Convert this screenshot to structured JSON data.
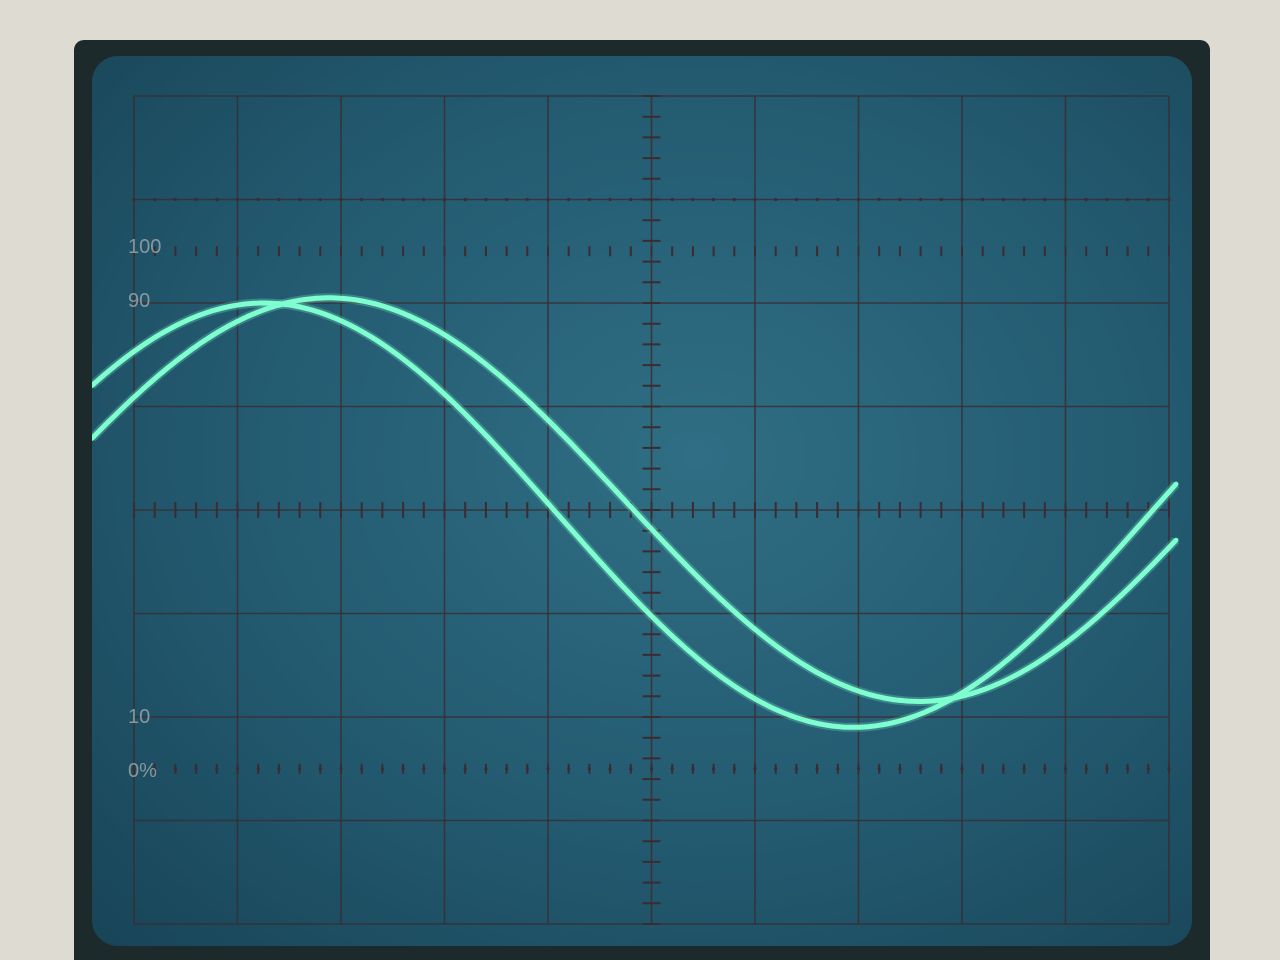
{
  "graticule": {
    "label_100": "100",
    "label_90": "90",
    "label_10": "10",
    "label_0": "0%"
  },
  "colors": {
    "trace": "#7fffd0",
    "grid": "#3a2c30",
    "screen": "#2a6a80",
    "bezel": "#1d2a2c"
  },
  "traces": [
    {
      "name": "",
      "amplitude_div": 2.05,
      "offset_div": -0.05,
      "phase_deg": 8,
      "period_div": 11.4
    },
    {
      "name": "",
      "amplitude_div": 1.95,
      "offset_div": 0.1,
      "phase_deg": 28,
      "period_div": 11.4
    }
  ]
}
